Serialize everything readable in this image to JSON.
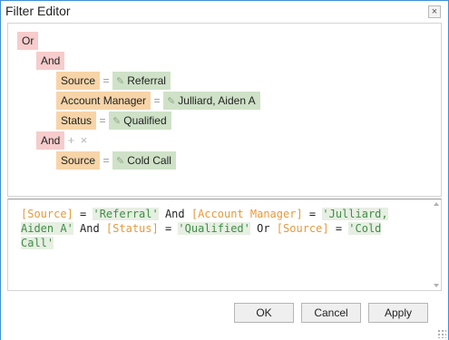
{
  "window": {
    "title": "Filter Editor",
    "close_glyph": "×"
  },
  "tree": {
    "root_group": "Or",
    "group1": {
      "label": "And",
      "conditions": [
        {
          "field": "Source",
          "op": "=",
          "value": "Referral"
        },
        {
          "field": "Account Manager",
          "op": "=",
          "value": "Julliard, Aiden A"
        },
        {
          "field": "Status",
          "op": "=",
          "value": "Qualified"
        }
      ]
    },
    "group2": {
      "label": "And",
      "add_glyph": "+",
      "remove_glyph": "×",
      "conditions": [
        {
          "field": "Source",
          "op": "=",
          "value": "Cold Call"
        }
      ]
    }
  },
  "expression": {
    "tokens": [
      {
        "t": "field",
        "s": "[Source]"
      },
      {
        "t": "op",
        "s": " = "
      },
      {
        "t": "value",
        "s": "'Referral'"
      },
      {
        "t": "op",
        "s": " And "
      },
      {
        "t": "field",
        "s": "[Account Manager]"
      },
      {
        "t": "op",
        "s": " = "
      },
      {
        "t": "value",
        "s": "'Julliard, Aiden A'"
      },
      {
        "t": "op",
        "s": " And "
      },
      {
        "t": "field",
        "s": "[Status]"
      },
      {
        "t": "op",
        "s": " = "
      },
      {
        "t": "value",
        "s": "'Qualified'"
      },
      {
        "t": "op",
        "s": " Or "
      },
      {
        "t": "field",
        "s": "[Source]"
      },
      {
        "t": "op",
        "s": " = "
      },
      {
        "t": "value",
        "s": "'Cold Call'"
      }
    ]
  },
  "buttons": {
    "ok": "OK",
    "cancel": "Cancel",
    "apply": "Apply"
  },
  "icons": {
    "value_edit": "pencil-icon",
    "close": "close-icon"
  },
  "colors": {
    "group": "#f6cccc",
    "field": "#f7d4a8",
    "value": "#cfe2c8",
    "field_text": "#e59a3c",
    "value_text": "#3f8e45",
    "window_border": "#3c8fd6"
  }
}
